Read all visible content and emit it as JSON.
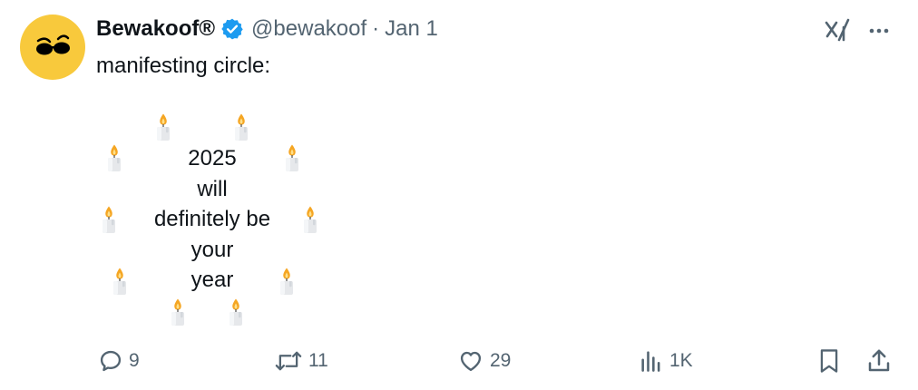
{
  "author": {
    "name": "Bewakoof®",
    "handle": "@bewakoof",
    "separator": "·",
    "date": "Jan 1",
    "avatar_icon": "sunglasses-face-logo",
    "verified_icon": "verified-badge-icon"
  },
  "tweet": {
    "text": "manifesting circle:",
    "circle_lines": [
      "2025",
      "will",
      "definitely be",
      "your",
      "year"
    ],
    "candle_icon": "candle-emoji",
    "candle_count": 10
  },
  "actions": {
    "replies": "9",
    "reposts": "11",
    "likes": "29",
    "views": "1K"
  },
  "colors": {
    "avatar_bg": "#f8c93c",
    "verified_blue": "#1d9bf0",
    "muted": "#536471",
    "text": "#0f1419"
  }
}
